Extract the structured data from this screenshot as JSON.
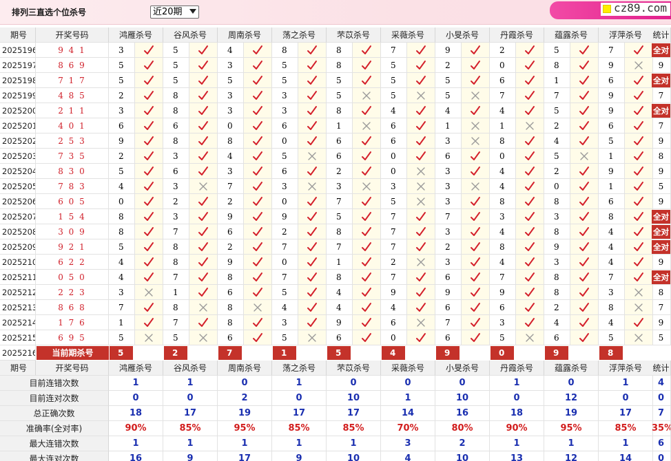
{
  "top": {
    "title": "排列三直选个位杀号",
    "select_value": "近20期",
    "brand": "cz89.com"
  },
  "headers": {
    "issue": "期号",
    "draw": "开奖号码",
    "experts": [
      "鸿雁杀号",
      "谷风杀号",
      "周南杀号",
      "荡之杀号",
      "芣苡杀号",
      "采薇杀号",
      "小旻杀号",
      "丹霞杀号",
      "蕴露杀号",
      "浮萍杀号"
    ],
    "stat": "统计"
  },
  "rows": [
    {
      "issue": "2025196",
      "draw": "9 4 1",
      "kills": [
        "3",
        "5",
        "4",
        "8",
        "8",
        "7",
        "9",
        "2",
        "5",
        "7"
      ],
      "ok": [
        1,
        1,
        1,
        1,
        1,
        1,
        1,
        1,
        1,
        1
      ],
      "stat": "全对"
    },
    {
      "issue": "2025197",
      "draw": "8 6 9",
      "kills": [
        "5",
        "5",
        "3",
        "5",
        "8",
        "5",
        "2",
        "0",
        "8",
        "9"
      ],
      "ok": [
        1,
        1,
        1,
        1,
        1,
        1,
        1,
        1,
        1,
        0
      ],
      "stat": "9"
    },
    {
      "issue": "2025198",
      "draw": "7 1 7",
      "kills": [
        "5",
        "5",
        "5",
        "5",
        "5",
        "5",
        "5",
        "6",
        "1",
        "6"
      ],
      "ok": [
        1,
        1,
        1,
        1,
        1,
        1,
        1,
        1,
        1,
        1
      ],
      "stat": "全对"
    },
    {
      "issue": "2025199",
      "draw": "4 8 5",
      "kills": [
        "2",
        "8",
        "3",
        "3",
        "5",
        "5",
        "5",
        "7",
        "7",
        "9"
      ],
      "ok": [
        1,
        1,
        1,
        1,
        0,
        0,
        0,
        1,
        1,
        1
      ],
      "stat": "7"
    },
    {
      "issue": "2025200",
      "draw": "2 1 1",
      "kills": [
        "3",
        "8",
        "3",
        "3",
        "8",
        "4",
        "4",
        "4",
        "5",
        "9"
      ],
      "ok": [
        1,
        1,
        1,
        1,
        1,
        1,
        1,
        1,
        1,
        1
      ],
      "stat": "全对"
    },
    {
      "issue": "2025201",
      "draw": "4 0 1",
      "kills": [
        "6",
        "6",
        "0",
        "6",
        "1",
        "6",
        "1",
        "1",
        "2",
        "6"
      ],
      "ok": [
        1,
        1,
        1,
        1,
        0,
        1,
        0,
        0,
        1,
        1
      ],
      "stat": "7"
    },
    {
      "issue": "2025202",
      "draw": "2 5 3",
      "kills": [
        "9",
        "8",
        "8",
        "0",
        "6",
        "6",
        "3",
        "8",
        "4",
        "5"
      ],
      "ok": [
        1,
        1,
        1,
        1,
        1,
        1,
        0,
        1,
        1,
        1
      ],
      "stat": "9"
    },
    {
      "issue": "2025203",
      "draw": "7 3 5",
      "kills": [
        "2",
        "3",
        "4",
        "5",
        "6",
        "0",
        "6",
        "0",
        "5",
        "1"
      ],
      "ok": [
        1,
        1,
        1,
        0,
        1,
        1,
        1,
        1,
        0,
        1
      ],
      "stat": "8"
    },
    {
      "issue": "2025204",
      "draw": "8 3 0",
      "kills": [
        "5",
        "6",
        "3",
        "6",
        "2",
        "0",
        "3",
        "4",
        "2",
        "9"
      ],
      "ok": [
        1,
        1,
        1,
        1,
        1,
        0,
        1,
        1,
        1,
        1
      ],
      "stat": "9"
    },
    {
      "issue": "2025205",
      "draw": "7 8 3",
      "kills": [
        "4",
        "3",
        "7",
        "3",
        "3",
        "3",
        "3",
        "4",
        "0",
        "1"
      ],
      "ok": [
        1,
        0,
        1,
        0,
        0,
        0,
        0,
        1,
        1,
        1
      ],
      "stat": "5"
    },
    {
      "issue": "2025206",
      "draw": "6 0 5",
      "kills": [
        "0",
        "2",
        "2",
        "0",
        "7",
        "5",
        "3",
        "8",
        "8",
        "6"
      ],
      "ok": [
        1,
        1,
        1,
        1,
        1,
        0,
        1,
        1,
        1,
        1
      ],
      "stat": "9"
    },
    {
      "issue": "2025207",
      "draw": "1 5 4",
      "kills": [
        "8",
        "3",
        "9",
        "9",
        "5",
        "7",
        "7",
        "3",
        "3",
        "8"
      ],
      "ok": [
        1,
        1,
        1,
        1,
        1,
        1,
        1,
        1,
        1,
        1
      ],
      "stat": "全对"
    },
    {
      "issue": "2025208",
      "draw": "3 0 9",
      "kills": [
        "8",
        "7",
        "6",
        "2",
        "8",
        "7",
        "3",
        "4",
        "8",
        "4"
      ],
      "ok": [
        1,
        1,
        1,
        1,
        1,
        1,
        1,
        1,
        1,
        1
      ],
      "stat": "全对"
    },
    {
      "issue": "2025209",
      "draw": "9 2 1",
      "kills": [
        "5",
        "8",
        "2",
        "7",
        "7",
        "7",
        "2",
        "8",
        "9",
        "4"
      ],
      "ok": [
        1,
        1,
        1,
        1,
        1,
        1,
        1,
        1,
        1,
        1
      ],
      "stat": "全对"
    },
    {
      "issue": "2025210",
      "draw": "6 2 2",
      "kills": [
        "4",
        "8",
        "9",
        "0",
        "1",
        "2",
        "3",
        "4",
        "3",
        "4"
      ],
      "ok": [
        1,
        1,
        1,
        1,
        1,
        0,
        1,
        1,
        1,
        1
      ],
      "stat": "9"
    },
    {
      "issue": "2025211",
      "draw": "0 5 0",
      "kills": [
        "4",
        "7",
        "8",
        "7",
        "8",
        "7",
        "6",
        "7",
        "8",
        "7"
      ],
      "ok": [
        1,
        1,
        1,
        1,
        1,
        1,
        1,
        1,
        1,
        1
      ],
      "stat": "全对"
    },
    {
      "issue": "2025212",
      "draw": "2 2 3",
      "kills": [
        "3",
        "1",
        "6",
        "5",
        "4",
        "9",
        "9",
        "9",
        "8",
        "3"
      ],
      "ok": [
        0,
        1,
        1,
        1,
        1,
        1,
        1,
        1,
        1,
        0
      ],
      "stat": "8"
    },
    {
      "issue": "2025213",
      "draw": "8 6 8",
      "kills": [
        "7",
        "8",
        "8",
        "4",
        "4",
        "4",
        "6",
        "6",
        "2",
        "8"
      ],
      "ok": [
        1,
        0,
        0,
        1,
        1,
        1,
        1,
        1,
        1,
        0
      ],
      "stat": "7"
    },
    {
      "issue": "2025214",
      "draw": "1 7 6",
      "kills": [
        "1",
        "7",
        "8",
        "3",
        "9",
        "6",
        "7",
        "3",
        "4",
        "4"
      ],
      "ok": [
        1,
        1,
        1,
        1,
        1,
        0,
        1,
        1,
        1,
        1
      ],
      "stat": "9"
    },
    {
      "issue": "2025215",
      "draw": "6 9 5",
      "kills": [
        "5",
        "5",
        "6",
        "5",
        "6",
        "0",
        "6",
        "5",
        "6",
        "5"
      ],
      "ok": [
        0,
        0,
        1,
        0,
        1,
        1,
        1,
        0,
        1,
        0
      ],
      "stat": "5"
    }
  ],
  "current": {
    "issue": "2025216",
    "label": "当前期杀号",
    "kills": [
      "5",
      "2",
      "7",
      "1",
      "5",
      "4",
      "9",
      "0",
      "9",
      "8"
    ]
  },
  "stats": [
    {
      "label": "目前连错次数",
      "values": [
        "1",
        "1",
        "0",
        "1",
        "0",
        "0",
        "0",
        "1",
        "0",
        "1"
      ],
      "total": "4",
      "red": false
    },
    {
      "label": "目前连对次数",
      "values": [
        "0",
        "0",
        "2",
        "0",
        "10",
        "1",
        "10",
        "0",
        "12",
        "0"
      ],
      "total": "0",
      "red": false
    },
    {
      "label": "总正确次数",
      "values": [
        "18",
        "17",
        "19",
        "17",
        "17",
        "14",
        "16",
        "18",
        "19",
        "17"
      ],
      "total": "7",
      "red": false
    },
    {
      "label": "准确率(全对率)",
      "values": [
        "90%",
        "85%",
        "95%",
        "85%",
        "85%",
        "70%",
        "80%",
        "90%",
        "95%",
        "85%"
      ],
      "total": "35%",
      "red": true
    },
    {
      "label": "最大连错次数",
      "values": [
        "1",
        "1",
        "1",
        "1",
        "1",
        "3",
        "2",
        "1",
        "1",
        "1"
      ],
      "total": "6",
      "red": false
    },
    {
      "label": "最大连对次数",
      "values": [
        "16",
        "9",
        "17",
        "9",
        "10",
        "4",
        "10",
        "13",
        "12",
        "14"
      ],
      "total": "0",
      "red": false
    }
  ],
  "colors": {
    "accent_red": "#c4322a",
    "check": "#d4212c",
    "cross": "#9a9a9a",
    "stat_blue": "#1a2fb0",
    "highlight_bg": "#fffce9"
  }
}
